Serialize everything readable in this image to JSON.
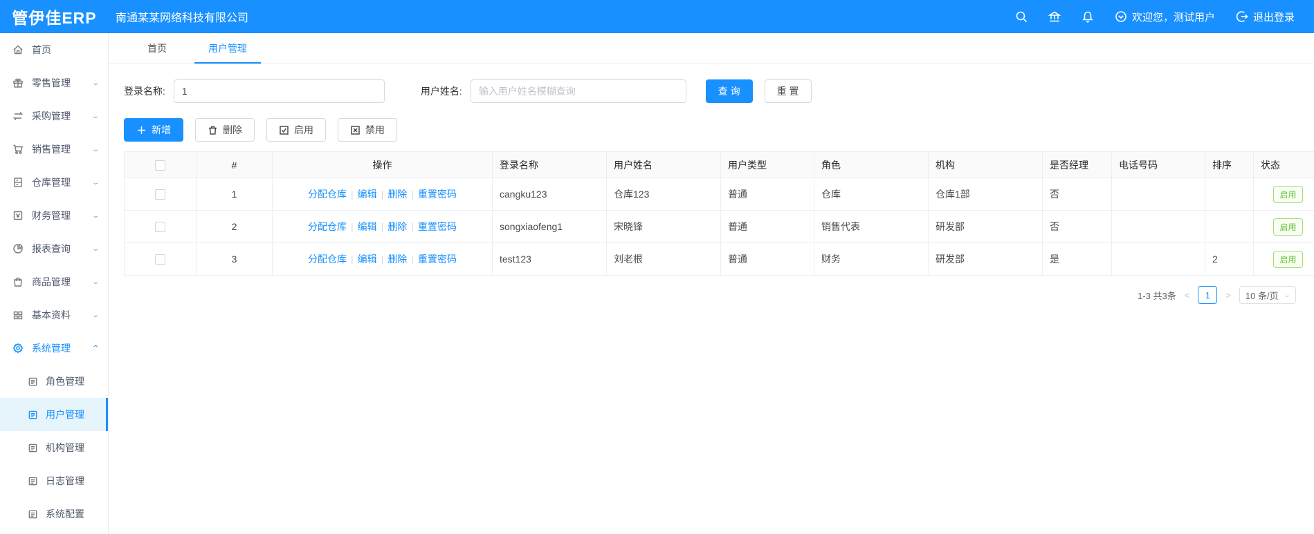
{
  "colors": {
    "primary": "#1890ff",
    "header_bg": "#1890ff",
    "success": "#67c23a",
    "active_sub_bg": "#e6f4fb"
  },
  "header": {
    "logo": "管伊佳ERP",
    "company": "南通某某网络科技有限公司",
    "welcome": "欢迎您，测试用户",
    "logout": "退出登录",
    "icons": [
      "search-icon",
      "bank-icon",
      "bell-icon",
      "down-circle-icon",
      "logout-icon"
    ]
  },
  "sidebar": {
    "items": [
      {
        "label": "首页",
        "icon": "home-icon",
        "expandable": false
      },
      {
        "label": "零售管理",
        "icon": "gift-icon",
        "expandable": true
      },
      {
        "label": "采购管理",
        "icon": "swap-icon",
        "expandable": true
      },
      {
        "label": "销售管理",
        "icon": "cart-icon",
        "expandable": true
      },
      {
        "label": "仓库管理",
        "icon": "warehouse-icon",
        "expandable": true
      },
      {
        "label": "财务管理",
        "icon": "finance-icon",
        "expandable": true
      },
      {
        "label": "报表查询",
        "icon": "pie-chart-icon",
        "expandable": true
      },
      {
        "label": "商品管理",
        "icon": "bag-icon",
        "expandable": true
      },
      {
        "label": "基本资料",
        "icon": "grid-icon",
        "expandable": true
      },
      {
        "label": "系统管理",
        "icon": "gear-icon",
        "expandable": true,
        "expanded": true,
        "active": true
      }
    ],
    "sub_items": [
      {
        "label": "角色管理",
        "icon": "doc-icon",
        "active": false
      },
      {
        "label": "用户管理",
        "icon": "doc-icon",
        "active": true
      },
      {
        "label": "机构管理",
        "icon": "doc-icon",
        "active": false
      },
      {
        "label": "日志管理",
        "icon": "doc-icon",
        "active": false
      },
      {
        "label": "系统配置",
        "icon": "doc-icon",
        "active": false
      }
    ]
  },
  "tabs": [
    {
      "label": "首页",
      "active": false
    },
    {
      "label": "用户管理",
      "active": true
    }
  ],
  "search": {
    "login_label": "登录名称:",
    "login_value": "1",
    "name_label": "用户姓名:",
    "name_placeholder": "输入用户姓名模糊查询",
    "query_label": "查 询",
    "reset_label": "重 置"
  },
  "toolbar": {
    "add_label": "新增",
    "delete_label": "删除",
    "enable_label": "启用",
    "disable_label": "禁用"
  },
  "table": {
    "columns": [
      "#",
      "操作",
      "登录名称",
      "用户姓名",
      "用户类型",
      "角色",
      "机构",
      "是否经理",
      "电话号码",
      "排序",
      "状态"
    ],
    "action_links": [
      "分配仓库",
      "编辑",
      "删除",
      "重置密码"
    ],
    "rows": [
      {
        "index": "1",
        "login": "cangku123",
        "name": "仓库123",
        "type": "普通",
        "role": "仓库",
        "org": "仓库1部",
        "manager": "否",
        "phone": "",
        "sort": "",
        "status": "启用"
      },
      {
        "index": "2",
        "login": "songxiaofeng1",
        "name": "宋晓锋",
        "type": "普通",
        "role": "销售代表",
        "org": "研发部",
        "manager": "否",
        "phone": "",
        "sort": "",
        "status": "启用"
      },
      {
        "index": "3",
        "login": "test123",
        "name": "刘老根",
        "type": "普通",
        "role": "财务",
        "org": "研发部",
        "manager": "是",
        "phone": "",
        "sort": "2",
        "status": "启用"
      }
    ]
  },
  "pagination": {
    "total_text": "1-3 共3条",
    "current_page": "1",
    "page_size": "10 条/页"
  }
}
